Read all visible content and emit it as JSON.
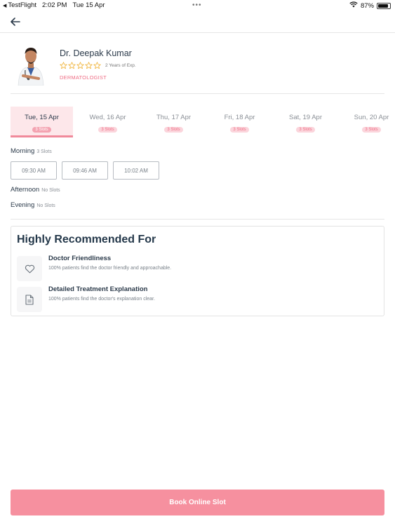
{
  "status_bar": {
    "app": "TestFlight",
    "time": "2:02 PM",
    "date": "Tue 15 Apr",
    "battery": "87%",
    "battery_level": 0.87
  },
  "doctor": {
    "name": "Dr. Deepak Kumar",
    "rating": 0,
    "max_rating": 5,
    "experience": "2 Years of Exp.",
    "specialty": "DERMATOLOGIST"
  },
  "dates": [
    {
      "label": "Tue, 15 Apr",
      "slots": "3 Slots",
      "active": true
    },
    {
      "label": "Wed, 16 Apr",
      "slots": "3 Slots",
      "active": false
    },
    {
      "label": "Thu, 17 Apr",
      "slots": "3 Slots",
      "active": false
    },
    {
      "label": "Fri, 18 Apr",
      "slots": "3 Slots",
      "active": false
    },
    {
      "label": "Sat, 19 Apr",
      "slots": "3 Slots",
      "active": false
    },
    {
      "label": "Sun, 20 Apr",
      "slots": "3 Slots",
      "active": false
    }
  ],
  "sessions": {
    "morning": {
      "label": "Morning",
      "sub": "3 Slots",
      "slots": [
        "09:30 AM",
        "09:46 AM",
        "10:02 AM"
      ]
    },
    "afternoon": {
      "label": "Afternoon",
      "sub": "No Slots"
    },
    "evening": {
      "label": "Evening",
      "sub": "No Slots"
    }
  },
  "recommended": {
    "title": "Highly Recommended For",
    "items": [
      {
        "title": "Doctor Friendliness",
        "desc": "100% patients find the doctor friendly and approachable.",
        "icon": "heart-icon"
      },
      {
        "title": "Detailed Treatment Explanation",
        "desc": "100% patients find the doctor's explanation clear.",
        "icon": "document-icon"
      }
    ]
  },
  "book_button": "Book Online Slot",
  "colors": {
    "accent": "#f6909f",
    "accent_light": "#fde7ea",
    "specialty": "#ef6f86",
    "star": "#f0b43a"
  }
}
